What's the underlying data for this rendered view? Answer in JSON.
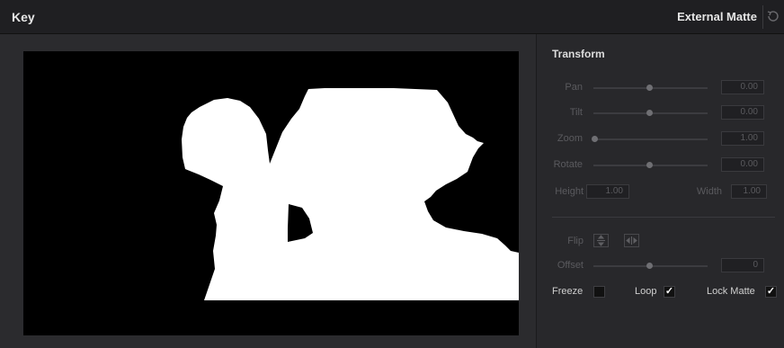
{
  "header": {
    "title": "Key",
    "mode": "External Matte"
  },
  "panel": {
    "title": "Transform",
    "pan": {
      "label": "Pan",
      "value": "0.00"
    },
    "tilt": {
      "label": "Tilt",
      "value": "0.00"
    },
    "zoom": {
      "label": "Zoom",
      "value": "1.00"
    },
    "rotate": {
      "label": "Rotate",
      "value": "0.00"
    },
    "height": {
      "label": "Height",
      "value": "1.00"
    },
    "width": {
      "label": "Width",
      "value": "1.00"
    },
    "flip": {
      "label": "Flip",
      "vertical_icon": "flip-vertical-icon",
      "horizontal_icon": "flip-horizontal-icon"
    },
    "offset": {
      "label": "Offset",
      "value": "0"
    },
    "freeze": {
      "label": "Freeze",
      "checked": false
    },
    "loop": {
      "label": "Loop",
      "checked": true,
      "mark": "✓"
    },
    "lock_matte": {
      "label": "Lock Matte",
      "checked": true,
      "mark": "✓"
    }
  },
  "colors": {
    "panel_bg": "#28282b",
    "header_bg": "#1f1f22",
    "accent": "#ffffff"
  }
}
